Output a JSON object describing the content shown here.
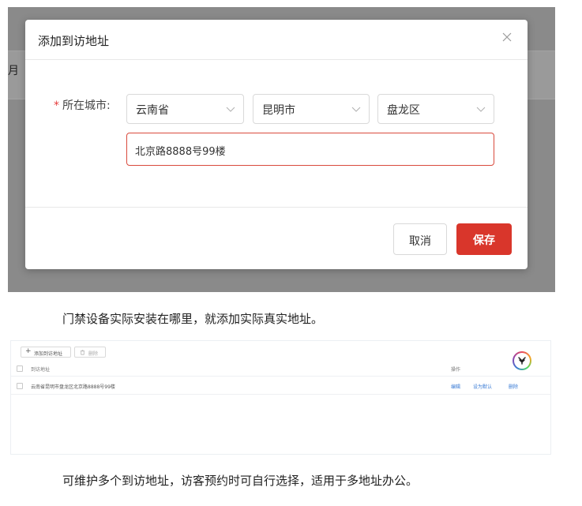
{
  "dialog": {
    "title": "添加到访地址",
    "close_icon": "close-icon",
    "field_label": "所在城市:",
    "required_mark": "*",
    "province": "云南省",
    "city": "昆明市",
    "district": "盘龙区",
    "address_value": "北京路8888号99楼",
    "cancel_label": "取消",
    "save_label": "保存",
    "background_fragment": "月"
  },
  "colors": {
    "primary": "#d9362b",
    "backdrop": "#8a8a8a",
    "link": "#3a7bd5"
  },
  "caption1": "门禁设备实际安装在哪里，就添加实际真实地址。",
  "list": {
    "add_button": "添加到访地址",
    "delete_button": "删除",
    "col_address": "到访地址",
    "col_action": "操作",
    "rows": [
      {
        "address": "云南省昆明市盘龙区北京路8888号99楼",
        "edit": "编辑",
        "set_default": "设为默认",
        "delete": "删除"
      }
    ]
  },
  "caption2": "可维护多个到访地址，访客预约时可自行选择，适用于多地址办公。"
}
